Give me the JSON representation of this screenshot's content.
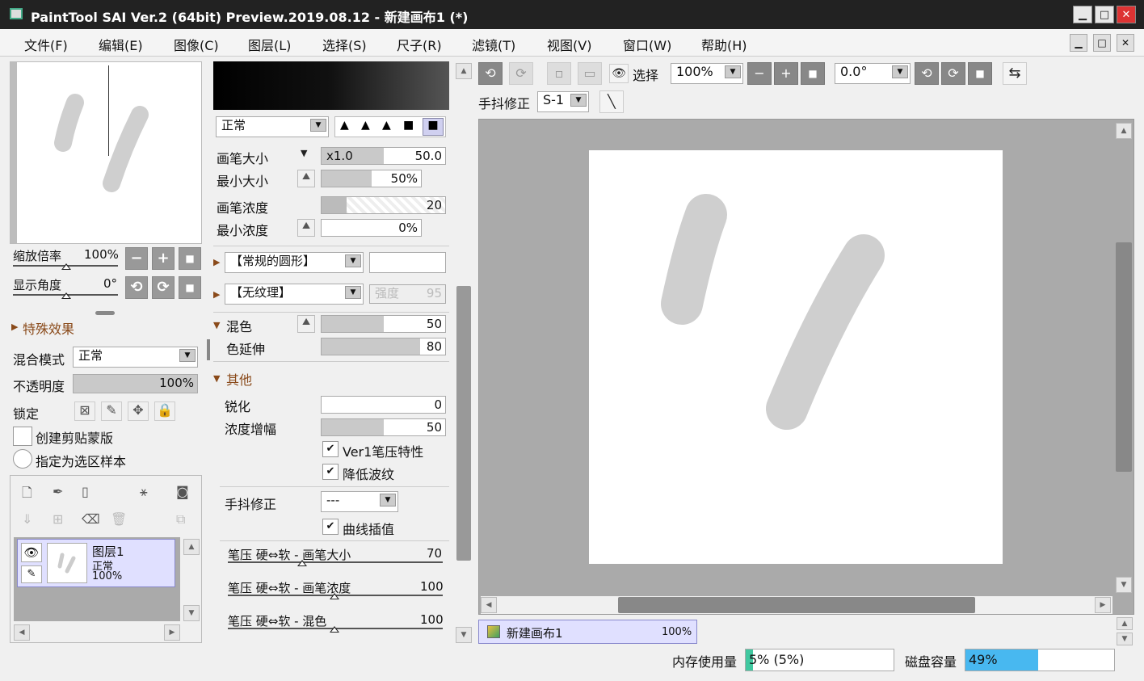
{
  "window": {
    "title": "PaintTool SAI Ver.2 (64bit) Preview.2019.08.12 - 新建画布1 (*)",
    "min": "▁",
    "max": "□",
    "close": "✕"
  },
  "menu": [
    "文件(F)",
    "编辑(E)",
    "图像(C)",
    "图层(L)",
    "选择(S)",
    "尺子(R)",
    "滤镜(T)",
    "视图(V)",
    "窗口(W)",
    "帮助(H)"
  ],
  "navigator": {
    "zoom_label": "缩放倍率",
    "zoom_value": "100%",
    "angle_label": "显示角度",
    "angle_value": "0°",
    "minus": "−",
    "plus": "+",
    "reset": "■",
    "rot_left": "⟲",
    "rot_right": "⟳"
  },
  "effects": {
    "label": "特殊效果"
  },
  "layer_props": {
    "blend_label": "混合模式",
    "blend_value": "正常",
    "opacity_label": "不透明度",
    "opacity_value": "100%",
    "opacity_percent": 100,
    "lock_label": "锁定",
    "clip_label": "创建剪贴蒙版",
    "sample_label": "指定为选区样本"
  },
  "layer": {
    "name": "图层1",
    "mode": "正常",
    "opacity": "100%"
  },
  "brush": {
    "mode": "正常",
    "size_label": "画笔大小",
    "size_mult": "x1.0",
    "size_value": "50.0",
    "min_size_label": "最小大小",
    "min_size_value": "50%",
    "min_size_percent": 50,
    "density_label": "画笔浓度",
    "density_value": "20",
    "min_density_label": "最小浓度",
    "min_density_value": "0%",
    "shape_value": "【常规的圆形】",
    "texture_value": "【无纹理】",
    "strength_label": "强度",
    "strength_value": "95",
    "mix_label": "混色",
    "mix_value": "50",
    "mix_percent": 50,
    "spread_label": "色延伸",
    "spread_value": "80",
    "spread_percent": 80,
    "other_label": "其他",
    "sharp_label": "锐化",
    "sharp_value": "0",
    "amp_label": "浓度增幅",
    "amp_value": "50",
    "amp_percent": 50,
    "ver1_label": "Ver1笔压特性",
    "ripple_label": "降低波纹",
    "stab_label": "手抖修正",
    "stab_value": "---",
    "curve_label": "曲线插值",
    "p1_label": "笔压 硬⇔软 - 画笔大小",
    "p1_value": "70",
    "p2_label": "笔压 硬⇔软 - 画笔浓度",
    "p2_value": "100",
    "p3_label": "笔压 硬⇔软 - 混色",
    "p3_value": "100"
  },
  "toolbar": {
    "select_label": "选择",
    "zoom": "100%",
    "angle": "0.0°",
    "stab_label": "手抖修正",
    "stab_value": "S-1"
  },
  "canvas_tab": {
    "name": "新建画布1",
    "zoom": "100%"
  },
  "status": {
    "mem_label": "内存使用量",
    "mem_value": "5% (5%)",
    "mem_percent": 5,
    "disk_label": "磁盘容量",
    "disk_value": "49%",
    "disk_percent": 49
  }
}
